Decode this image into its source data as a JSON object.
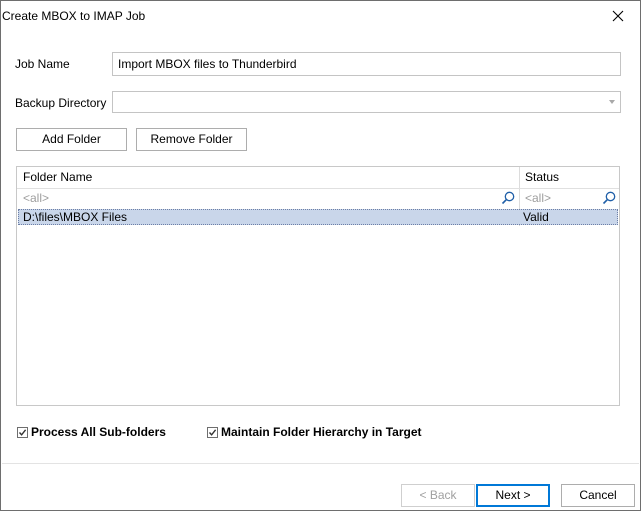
{
  "window": {
    "title": "Create MBOX to IMAP Job"
  },
  "form": {
    "job_name_label": "Job Name",
    "job_name_value": "Import MBOX files to Thunderbird",
    "backup_dir_label": "Backup Directory",
    "backup_dir_value": ""
  },
  "buttons": {
    "add_folder": "Add Folder",
    "remove_folder": "Remove Folder",
    "back": "< Back",
    "next": "Next >",
    "cancel": "Cancel"
  },
  "grid": {
    "columns": [
      "Folder Name",
      "Status"
    ],
    "filter_placeholder": [
      "<all>",
      "<all>"
    ],
    "rows": [
      {
        "folder": "D:\\files\\MBOX Files",
        "status": "Valid"
      }
    ]
  },
  "options": {
    "process_subfolders": {
      "label": "Process All Sub-folders",
      "checked": true
    },
    "maintain_hierarchy": {
      "label": "Maintain Folder Hierarchy in Target",
      "checked": true
    }
  }
}
